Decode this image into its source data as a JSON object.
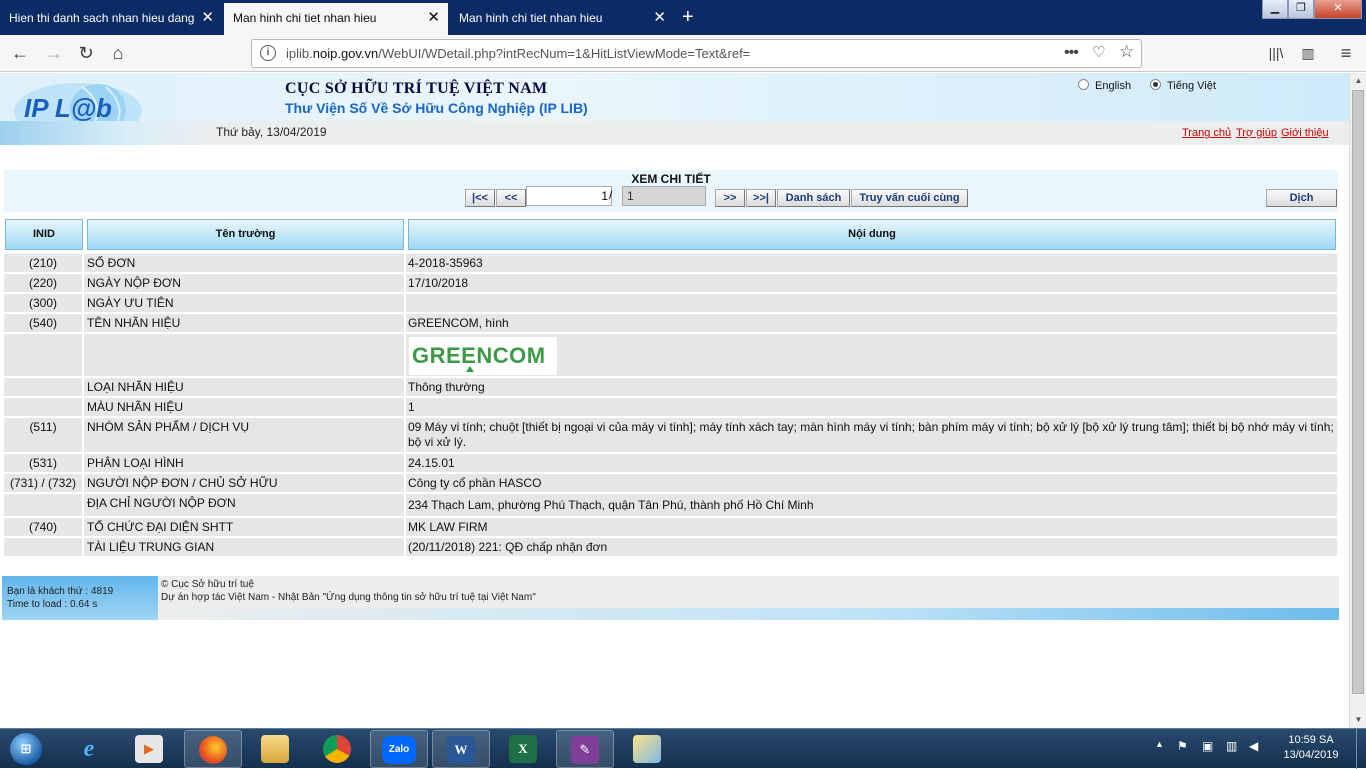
{
  "browser": {
    "tabs": [
      {
        "title": "Hien thi danh sach nhan hieu dang",
        "active": false
      },
      {
        "title": "Man hinh chi tiet nhan hieu",
        "active": true
      },
      {
        "title": "Man hinh chi tiet nhan hieu",
        "active": false
      }
    ],
    "url_prefix": "iplib.",
    "url_domain": "noip.gov.vn",
    "url_path": "/WebUI/WDetail.php?intRecNum=1&HitListViewMode=Text&ref="
  },
  "header": {
    "logo_text": "IP L@b",
    "title1": "CỤC SỞ HỮU TRÍ TUỆ VIỆT NAM",
    "title2": "Thư Viện Số Về Sở Hữu Công Nghiệp (IP LIB)",
    "lang_english": "English",
    "lang_vietnamese": "Tiếng Việt",
    "date": "Thứ bảy, 13/04/2019",
    "links": [
      "Trang chủ",
      "Trợ giúp",
      "Giới thiệu"
    ]
  },
  "detail": {
    "title": "XEM CHI TIẾT",
    "first": "|<<",
    "prev": "<<",
    "record_value": "1",
    "slash": "/",
    "total_value": "1",
    "next": ">>",
    "last": ">>|",
    "list": "Danh sách",
    "last_query": "Truy vấn cuối cùng",
    "translate": "Dịch"
  },
  "table": {
    "headers": [
      "INID",
      "Tên trường",
      "Nội dung"
    ],
    "rows": [
      {
        "inid": "(210)",
        "field": "SỐ ĐƠN",
        "value": "4-2018-35963"
      },
      {
        "inid": "(220)",
        "field": "NGÀY NỘP ĐƠN",
        "value": "17/10/2018"
      },
      {
        "inid": "(300)",
        "field": "NGÀY ƯU TIÊN",
        "value": ""
      },
      {
        "inid": "(540)",
        "field": "TÊN NHÃN HIỆU",
        "value": "GREENCOM, hình"
      },
      {
        "inid": "",
        "field": "",
        "value": ""
      },
      {
        "inid": "",
        "field": "LOẠI NHÃN HIỆU",
        "value": "Thông thường"
      },
      {
        "inid": "",
        "field": "MÀU NHÃN HIỆU",
        "value": "1"
      },
      {
        "inid": "(511)",
        "field": "NHÓM SẢN PHẨM / DỊCH VỤ",
        "value": "09 Máy vi tính; chuột [thiết bị ngoại vi của máy vi tính]; máy tính xách tay; màn hình máy vi tính; bàn phím máy vi tính; bộ xử lý [bộ xử lý trung tâm]; thiết bị bộ nhớ máy vi tính; bộ vi xử lý."
      },
      {
        "inid": "(531)",
        "field": "PHÂN LOẠI HÌNH",
        "value": "24.15.01"
      },
      {
        "inid": "(731) / (732)",
        "field": "NGƯỜI NỘP ĐƠN / CHỦ SỞ HỮU",
        "value": "Công ty cổ phần HASCO"
      },
      {
        "inid": "",
        "field": "ĐỊA CHỈ NGƯỜI NỘP ĐƠN",
        "value": "234 Thạch Lam, phường Phú Thạch, quận Tân Phú, thành phố Hồ Chí Minh"
      },
      {
        "inid": "(740)",
        "field": "TỔ CHỨC ĐẠI DIỆN SHTT",
        "value": "MK LAW FIRM"
      },
      {
        "inid": "",
        "field": "TÀI LIỆU TRUNG GIAN",
        "value": "(20/11/2018) 221: QĐ chấp nhận đơn"
      }
    ],
    "mark_image_text": "GREENCOM"
  },
  "footer": {
    "visitor": "Bạn là khách thứ : 4819",
    "load_time": "Time to load : 0.64 s",
    "copyright": "© Cục Sở hữu trí tuệ",
    "project": "Dự án hợp tác Việt Nam - Nhật Bản \"Ứng dụng thông tin sở hữu trí tuệ tại Việt Nam\""
  },
  "taskbar": {
    "time": "10:59 SA",
    "date": "13/04/2019",
    "zalo_label": "Zalo"
  },
  "colors": {
    "tabbar": "#0b2a66",
    "header_blue": "#1a66c4",
    "link_red": "#cc0000",
    "table_row": "#e6e6e6",
    "table_header": "#9fd9f5"
  }
}
